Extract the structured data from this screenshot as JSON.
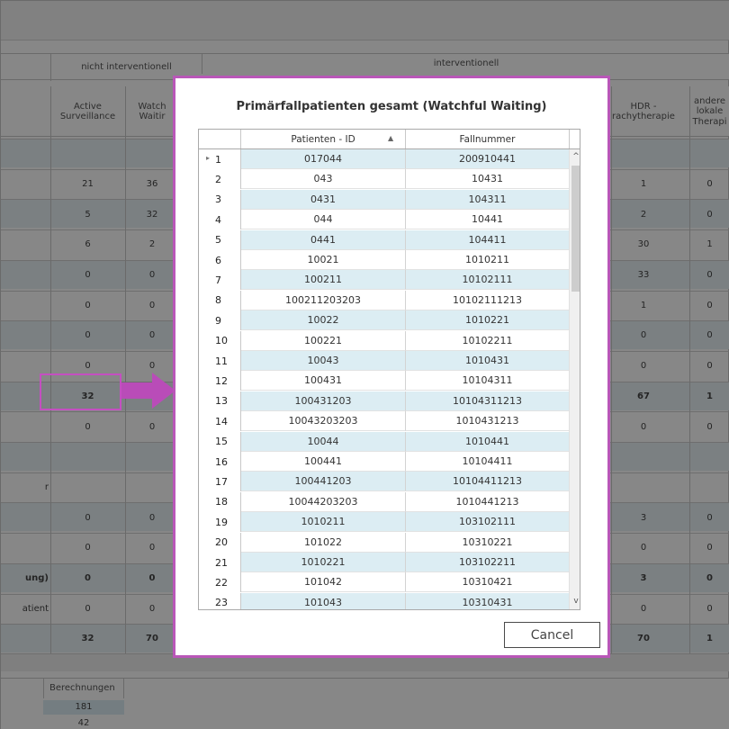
{
  "background": {
    "group_headers": {
      "non_interventional": "nicht interventionell",
      "interventional": "interventionell"
    },
    "columns": {
      "active_surveillance": "Active\nSurveillance",
      "watchful_waiting_partial": "Watch\nWaitir",
      "hdr_partial": "HDR -\nrachytherapie",
      "andere_partial": "andere\nlokale\nTherapi"
    },
    "rows": [
      {
        "left": "",
        "a": "",
        "b": "",
        "h": "",
        "x": ""
      },
      {
        "left": "",
        "a": "21",
        "b": "36",
        "h": "1",
        "x": "0"
      },
      {
        "left": "",
        "a": "5",
        "b": "32",
        "h": "2",
        "x": "0"
      },
      {
        "left": "",
        "a": "6",
        "b": "2",
        "h": "30",
        "x": "1"
      },
      {
        "left": "",
        "a": "0",
        "b": "0",
        "h": "33",
        "x": "0"
      },
      {
        "left": "",
        "a": "0",
        "b": "0",
        "h": "1",
        "x": "0"
      },
      {
        "left": "",
        "a": "0",
        "b": "0",
        "h": "0",
        "x": "0"
      },
      {
        "left": "",
        "a": "0",
        "b": "0",
        "h": "0",
        "x": "0"
      },
      {
        "left": "",
        "a": "32",
        "b": "",
        "h": "67",
        "x": "1"
      },
      {
        "left": "",
        "a": "0",
        "b": "0",
        "h": "0",
        "x": "0"
      },
      {
        "left": "",
        "a": "",
        "b": "",
        "h": "",
        "x": ""
      },
      {
        "left": "r",
        "a": "",
        "b": "",
        "h": "",
        "x": ""
      },
      {
        "left": "",
        "a": "0",
        "b": "0",
        "h": "3",
        "x": "0"
      },
      {
        "left": "",
        "a": "0",
        "b": "0",
        "h": "0",
        "x": "0"
      },
      {
        "left": "ung)",
        "a": "0",
        "b": "0",
        "h": "3",
        "x": "0"
      },
      {
        "left": "atient",
        "a": "0",
        "b": "0",
        "h": "0",
        "x": "0"
      },
      {
        "left": "",
        "a": "32",
        "b": "70",
        "h": "70",
        "x": "1"
      }
    ],
    "bottom": {
      "label": "Berechnungen",
      "values": [
        "181",
        "42"
      ]
    }
  },
  "modal": {
    "title": "Primärfallpatienten gesamt (Watchful Waiting)",
    "columns": [
      "Patienten - ID",
      "Fallnummer"
    ],
    "rows": [
      {
        "n": "1",
        "id": "017044",
        "fall": "200910441"
      },
      {
        "n": "2",
        "id": "043",
        "fall": "10431"
      },
      {
        "n": "3",
        "id": "0431",
        "fall": "104311"
      },
      {
        "n": "4",
        "id": "044",
        "fall": "10441"
      },
      {
        "n": "5",
        "id": "0441",
        "fall": "104411"
      },
      {
        "n": "6",
        "id": "10021",
        "fall": "1010211"
      },
      {
        "n": "7",
        "id": "100211",
        "fall": "10102111"
      },
      {
        "n": "8",
        "id": "100211203203",
        "fall": "10102111213"
      },
      {
        "n": "9",
        "id": "10022",
        "fall": "1010221"
      },
      {
        "n": "10",
        "id": "100221",
        "fall": "10102211"
      },
      {
        "n": "11",
        "id": "10043",
        "fall": "1010431"
      },
      {
        "n": "12",
        "id": "100431",
        "fall": "10104311"
      },
      {
        "n": "13",
        "id": "100431203",
        "fall": "10104311213"
      },
      {
        "n": "14",
        "id": "10043203203",
        "fall": "1010431213"
      },
      {
        "n": "15",
        "id": "10044",
        "fall": "1010441"
      },
      {
        "n": "16",
        "id": "100441",
        "fall": "10104411"
      },
      {
        "n": "17",
        "id": "100441203",
        "fall": "10104411213"
      },
      {
        "n": "18",
        "id": "10044203203",
        "fall": "1010441213"
      },
      {
        "n": "19",
        "id": "1010211",
        "fall": "103102111"
      },
      {
        "n": "20",
        "id": "101022",
        "fall": "10310221"
      },
      {
        "n": "21",
        "id": "1010221",
        "fall": "103102211"
      },
      {
        "n": "22",
        "id": "101042",
        "fall": "10310421"
      },
      {
        "n": "23",
        "id": "101043",
        "fall": "10310431"
      }
    ],
    "cancel_label": "Cancel"
  }
}
